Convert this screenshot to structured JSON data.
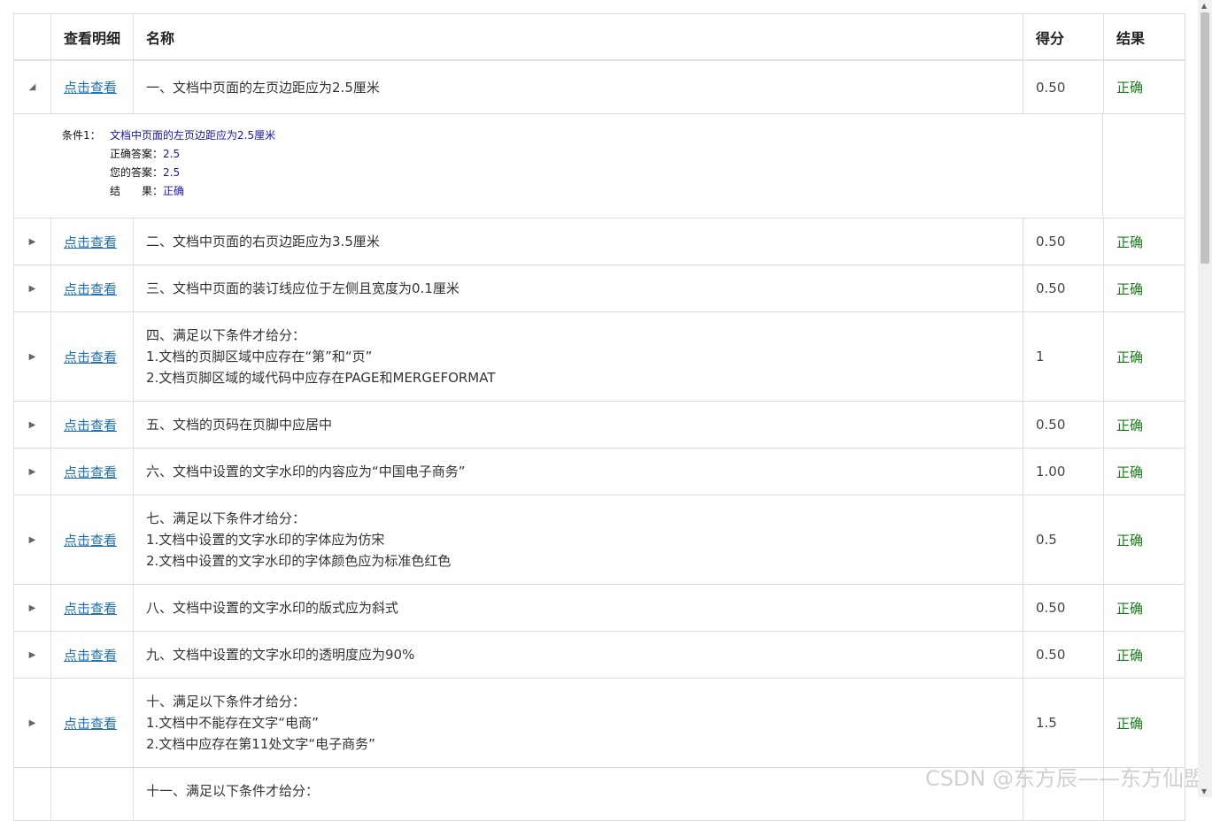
{
  "header": {
    "col_expand": "",
    "col_detail": "查看明细",
    "col_name": "名称",
    "col_score": "得分",
    "col_result": "结果"
  },
  "rows": [
    {
      "arrow": "◢",
      "link": "点击查看",
      "name": "一、文档中页面的左页边距应为2.5厘米",
      "score": "0.50",
      "result": "正确"
    },
    {
      "arrow": "▶",
      "link": "点击查看",
      "name": "二、文档中页面的右页边距应为3.5厘米",
      "score": "0.50",
      "result": "正确"
    },
    {
      "arrow": "▶",
      "link": "点击查看",
      "name": "三、文档中页面的装订线应位于左侧且宽度为0.1厘米",
      "score": "0.50",
      "result": "正确"
    },
    {
      "arrow": "▶",
      "link": "点击查看",
      "name": "四、满足以下条件才给分：\n1.文档的页脚区域中应存在“第”和“页”\n2.文档页脚区域的域代码中应存在PAGE和MERGEFORMAT",
      "score": "1",
      "result": "正确"
    },
    {
      "arrow": "▶",
      "link": "点击查看",
      "name": "五、文档的页码在页脚中应居中",
      "score": "0.50",
      "result": "正确"
    },
    {
      "arrow": "▶",
      "link": "点击查看",
      "name": "六、文档中设置的文字水印的内容应为“中国电子商务”",
      "score": "1.00",
      "result": "正确"
    },
    {
      "arrow": "▶",
      "link": "点击查看",
      "name": "七、满足以下条件才给分：\n1.文档中设置的文字水印的字体应为仿宋\n2.文档中设置的文字水印的字体颜色应为标准色红色",
      "score": "0.5",
      "result": "正确"
    },
    {
      "arrow": "▶",
      "link": "点击查看",
      "name": "八、文档中设置的文字水印的版式应为斜式",
      "score": "0.50",
      "result": "正确"
    },
    {
      "arrow": "▶",
      "link": "点击查看",
      "name": "九、文档中设置的文字水印的透明度应为90%",
      "score": "0.50",
      "result": "正确"
    },
    {
      "arrow": "▶",
      "link": "点击查看",
      "name": "十、满足以下条件才给分：\n1.文档中不能存在文字“电商”\n2.文档中应存在第11处文字“电子商务”",
      "score": "1.5",
      "result": "正确"
    },
    {
      "arrow": "",
      "link": "",
      "name": "十一、满足以下条件才给分：",
      "score": "",
      "result": ""
    }
  ],
  "detail": {
    "cond_label": "条件1：",
    "cond_text": "文档中页面的左页边距应为2.5厘米",
    "correct_label": "正确答案：",
    "correct_value": "2.5",
    "yours_label": "您的答案：",
    "yours_value": "2.5",
    "result_label": "结　　果：",
    "result_value": "正确"
  },
  "watermark": "CSDN @东方辰——东方仙盟",
  "colors": {
    "link": "#1a6fc0",
    "ok": "#177c17",
    "detail_value": "#1515b8",
    "border": "#dcdcdc"
  }
}
